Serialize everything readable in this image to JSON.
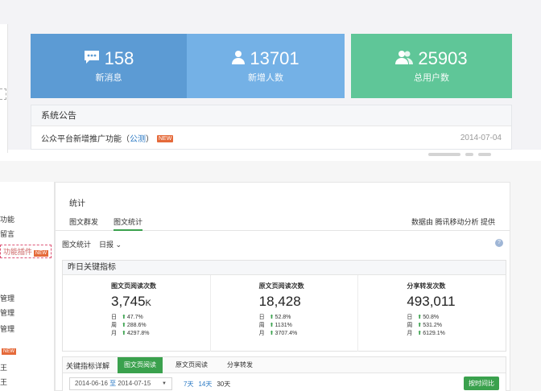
{
  "stats": [
    {
      "value": "158",
      "label": "新消息",
      "icon": "message-icon"
    },
    {
      "value": "13701",
      "label": "新增人数",
      "icon": "user-icon"
    },
    {
      "value": "25903",
      "label": "总用户数",
      "icon": "users-icon"
    }
  ],
  "notice": {
    "title": "系统公告",
    "item_text": "公众平台新增推广功能（",
    "item_link": "公测",
    "item_close": "）",
    "badge": "NEW",
    "date": "2014-07-04"
  },
  "sidebar": {
    "items": [
      "功能",
      "留言",
      "功能插件",
      "管理",
      "管理",
      "管理",
      "NEW",
      "王",
      "王"
    ]
  },
  "main": {
    "title": "统计",
    "tabs": [
      "图文群发",
      "图文统计"
    ],
    "data_source": "数据由 腾讯移动分析 提供",
    "sub_label": "图文统计",
    "sub_dropdown": "日报 ⌄",
    "help": "?"
  },
  "kpi": {
    "title": "昨日关键指标",
    "columns": [
      {
        "name": "图文页阅读次数",
        "value": "3,745",
        "unit": "K",
        "day": "47.7%",
        "week": "288.6%",
        "month": "4297.8%"
      },
      {
        "name": "原文页阅读次数",
        "value": "18,428",
        "unit": "",
        "day": "52.8%",
        "week": "1131%",
        "month": "3707.4%"
      },
      {
        "name": "分享转发次数",
        "value": "493,011",
        "unit": "",
        "day": "50.8%",
        "week": "531.2%",
        "month": "6129.1%"
      }
    ],
    "row_labels": {
      "day": "日",
      "week": "周",
      "month": "月"
    }
  },
  "detail": {
    "title": "关键指标详解",
    "tabs": [
      "图文页阅读",
      "原文页阅读",
      "分享转发"
    ],
    "date_from": "2014-06-16",
    "date_sep": "至",
    "date_to": "2014-07-15",
    "quick": [
      "7天",
      "14天",
      "30天"
    ],
    "download": "按时间比"
  },
  "colors": {
    "stat1": "#5c9bd4",
    "stat2": "#74b1e6",
    "stat3": "#5fc698",
    "accent_green": "#3aa14d"
  }
}
